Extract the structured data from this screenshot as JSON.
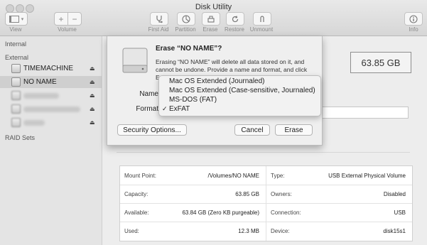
{
  "window": {
    "title": "Disk Utility"
  },
  "toolbar": {
    "view_label": "View",
    "volume_label": "Volume",
    "plus": "+",
    "minus": "−",
    "first_aid_label": "First Aid",
    "partition_label": "Partition",
    "erase_label": "Erase",
    "restore_label": "Restore",
    "unmount_label": "Unmount",
    "info_label": "Info"
  },
  "sidebar": {
    "internal_header": "Internal",
    "external_header": "External",
    "raid_header": "RAID Sets",
    "items": [
      {
        "label": "TIMEMACHINE"
      },
      {
        "label": "NO NAME"
      }
    ],
    "eject_glyph": "⏏"
  },
  "main": {
    "capacity": "63.85 GB"
  },
  "dialog": {
    "title": "Erase “NO NAME”?",
    "message": "Erasing “NO NAME” will delete all data stored on it, and cannot be undone. Provide a name and format, and click Erase to proceed.",
    "name_label": "Name",
    "format_label": "Format",
    "security_button": "Security Options...",
    "cancel_button": "Cancel",
    "erase_button": "Erase"
  },
  "format_menu": {
    "options": [
      "Mac OS Extended (Journaled)",
      "Mac OS Extended (Case-sensitive, Journaled)",
      "MS-DOS (FAT)",
      "ExFAT"
    ],
    "checkmark": "✓"
  },
  "info": {
    "left": [
      {
        "key": "Mount Point:",
        "value": "/Volumes/NO NAME"
      },
      {
        "key": "Capacity:",
        "value": "63.85 GB"
      },
      {
        "key": "Available:",
        "value": "63.84 GB (Zero KB purgeable)"
      },
      {
        "key": "Used:",
        "value": "12.3 MB"
      }
    ],
    "right": [
      {
        "key": "Type:",
        "value": "USB External Physical Volume"
      },
      {
        "key": "Owners:",
        "value": "Disabled"
      },
      {
        "key": "Connection:",
        "value": "USB"
      },
      {
        "key": "Device:",
        "value": "disk15s1"
      }
    ]
  }
}
